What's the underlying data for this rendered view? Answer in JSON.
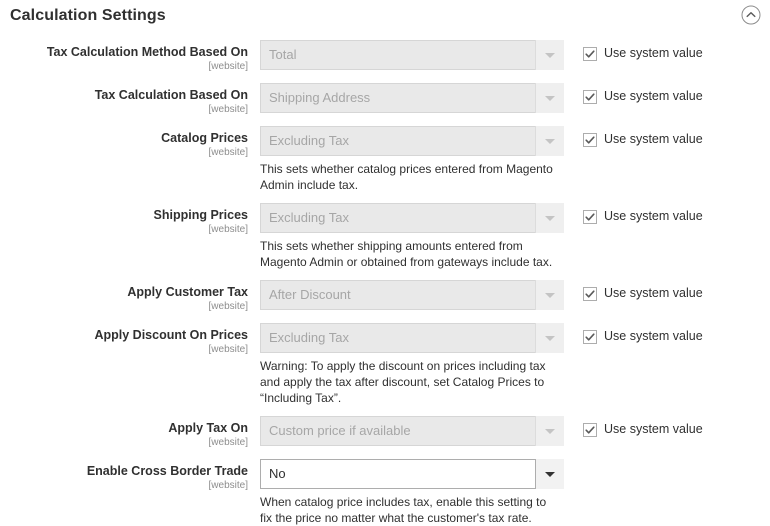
{
  "section": {
    "title": "Calculation Settings",
    "collapse_icon": "chevron-up-circle-icon",
    "scope_suffix": "[website]",
    "system_value_label": "Use system value"
  },
  "fields": [
    {
      "id": "tax-calculation-method-based-on",
      "label": "Tax Calculation Method Based On",
      "scope": "[website]",
      "value": "Total",
      "disabled": true,
      "note": "",
      "use_system_value": true
    },
    {
      "id": "tax-calculation-based-on",
      "label": "Tax Calculation Based On",
      "scope": "[website]",
      "value": "Shipping Address",
      "disabled": true,
      "note": "",
      "use_system_value": true
    },
    {
      "id": "catalog-prices",
      "label": "Catalog Prices",
      "scope": "[website]",
      "value": "Excluding Tax",
      "disabled": true,
      "note": "This sets whether catalog prices entered from Magento Admin include tax.",
      "use_system_value": true
    },
    {
      "id": "shipping-prices",
      "label": "Shipping Prices",
      "scope": "[website]",
      "value": "Excluding Tax",
      "disabled": true,
      "note": "This sets whether shipping amounts entered from Magento Admin or obtained from gateways include tax.",
      "use_system_value": true
    },
    {
      "id": "apply-customer-tax",
      "label": "Apply Customer Tax",
      "scope": "[website]",
      "value": "After Discount",
      "disabled": true,
      "note": "",
      "use_system_value": true
    },
    {
      "id": "apply-discount-on-prices",
      "label": "Apply Discount On Prices",
      "scope": "[website]",
      "value": "Excluding Tax",
      "disabled": true,
      "note": "Warning: To apply the discount on prices including tax and apply the tax after discount, set Catalog Prices to “Including Tax”.",
      "use_system_value": true
    },
    {
      "id": "apply-tax-on",
      "label": "Apply Tax On",
      "scope": "[website]",
      "value": "Custom price if available",
      "disabled": true,
      "note": "",
      "use_system_value": true
    },
    {
      "id": "enable-cross-border-trade",
      "label": "Enable Cross Border Trade",
      "scope": "[website]",
      "value": "No",
      "disabled": false,
      "note": "When catalog price includes tax, enable this setting to fix the price no matter what the customer's tax rate.",
      "use_system_value": false
    }
  ],
  "colors": {
    "text": "#303030",
    "muted": "#8d8d8d",
    "disabled_bg": "#e9e9e9",
    "disabled_text": "#a6a6a6",
    "border": "#adadad"
  }
}
